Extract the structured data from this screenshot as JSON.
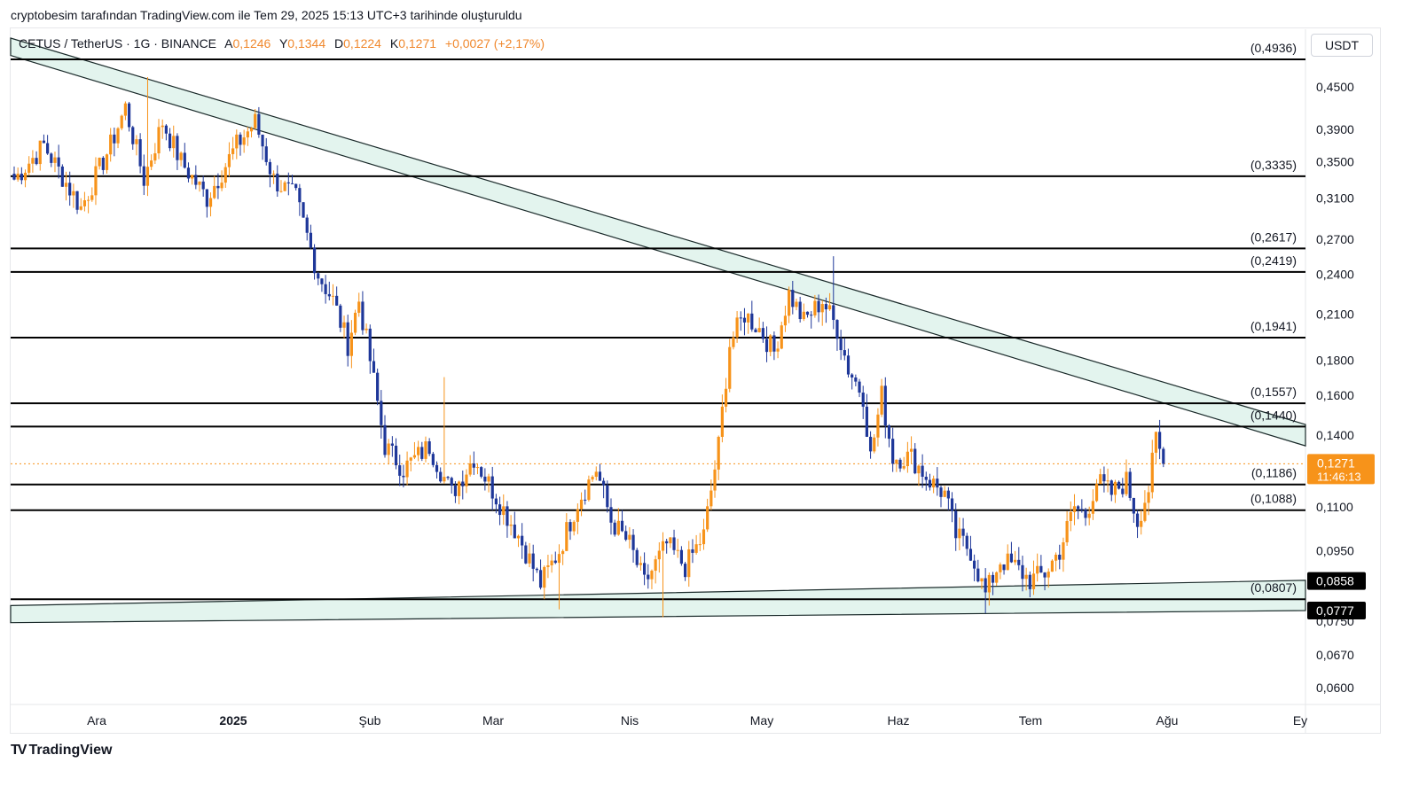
{
  "header": {
    "caption": "cryptobesim tarafından TradingView.com ile Tem 29, 2025 15:13 UTC+3 tarihinde oluşturuldu"
  },
  "symbol": {
    "name": "CETUS / TetherUS · 1G · BINANCE",
    "open_label": "A",
    "open": "0,1246",
    "high_label": "Y",
    "high": "0,1344",
    "low_label": "D",
    "low": "0,1224",
    "close_label": "K",
    "close": "0,1271",
    "change": "+0,0027 (+2,17%)"
  },
  "currency": "USDT",
  "footer": {
    "brand": "TradingView"
  },
  "colors": {
    "up": "#f7931a",
    "down": "#1e3799",
    "channel_fill": "#e3f4ee",
    "level_line": "#000000",
    "price_badge": "#f7931a"
  },
  "chart_data": {
    "type": "candlestick",
    "y_scale": "log",
    "ylim": [
      0.0567,
      0.546
    ],
    "y_ticks": [
      "0,4500",
      "0,3900",
      "0,3500",
      "0,3100",
      "0,2700",
      "0,2400",
      "0,2100",
      "0,1800",
      "0,1600",
      "0,1400",
      "0,1100",
      "0,0950",
      "0,0670",
      "0,0600",
      "0,0750"
    ],
    "x_ticks": [
      {
        "label": "Ara",
        "bold": false
      },
      {
        "label": "2025",
        "bold": true
      },
      {
        "label": "Şub",
        "bold": false
      },
      {
        "label": "Mar",
        "bold": false
      },
      {
        "label": "Nis",
        "bold": false
      },
      {
        "label": "May",
        "bold": false
      },
      {
        "label": "Haz",
        "bold": false
      },
      {
        "label": "Tem",
        "bold": false
      },
      {
        "label": "Ağu",
        "bold": false
      },
      {
        "label": "Ey",
        "bold": false
      }
    ],
    "levels": [
      "(0,4936)",
      "(0,3335)",
      "(0,2617)",
      "(0,2419)",
      "(0,1941)",
      "(0,1557)",
      "(0,1440)",
      "(0,1186)",
      "(0,1088)",
      "(0,0807)"
    ],
    "price_badges": [
      {
        "value": "0,1271",
        "timer": "11:46:13",
        "style": "current"
      },
      {
        "value": "0,0858",
        "style": "dark"
      },
      {
        "value": "0,0777",
        "style": "dark"
      }
    ],
    "channels": [
      {
        "name": "",
        "upper": [
          0.53,
          0.145
        ],
        "lower": [
          0.5,
          0.135
        ]
      },
      {
        "name": "",
        "upper": [
          0.079,
          0.086
        ],
        "lower": [
          0.0746,
          0.0777
        ]
      }
    ],
    "anchors": [
      {
        "day": 0,
        "close": 0.33
      },
      {
        "day": 8,
        "close": 0.37
      },
      {
        "day": 18,
        "close": 0.3
      },
      {
        "day": 26,
        "close": 0.37
      },
      {
        "day": 30,
        "close": 0.42
      },
      {
        "day": 35,
        "close": 0.33
      },
      {
        "day": 40,
        "close": 0.4
      },
      {
        "day": 45,
        "close": 0.35
      },
      {
        "day": 52,
        "close": 0.31
      },
      {
        "day": 60,
        "close": 0.37
      },
      {
        "day": 65,
        "close": 0.4
      },
      {
        "day": 70,
        "close": 0.33
      },
      {
        "day": 76,
        "close": 0.31
      },
      {
        "day": 82,
        "close": 0.24
      },
      {
        "day": 86,
        "close": 0.22
      },
      {
        "day": 90,
        "close": 0.19
      },
      {
        "day": 93,
        "close": 0.22
      },
      {
        "day": 96,
        "close": 0.18
      },
      {
        "day": 100,
        "close": 0.135
      },
      {
        "day": 105,
        "close": 0.125
      },
      {
        "day": 112,
        "close": 0.135
      },
      {
        "day": 118,
        "close": 0.115
      },
      {
        "day": 124,
        "close": 0.13
      },
      {
        "day": 130,
        "close": 0.114
      },
      {
        "day": 136,
        "close": 0.1
      },
      {
        "day": 142,
        "close": 0.085
      },
      {
        "day": 147,
        "close": 0.095
      },
      {
        "day": 152,
        "close": 0.112
      },
      {
        "day": 157,
        "close": 0.125
      },
      {
        "day": 161,
        "close": 0.105
      },
      {
        "day": 166,
        "close": 0.097
      },
      {
        "day": 170,
        "close": 0.085
      },
      {
        "day": 176,
        "close": 0.097
      },
      {
        "day": 181,
        "close": 0.09
      },
      {
        "day": 186,
        "close": 0.1
      },
      {
        "day": 190,
        "close": 0.135
      },
      {
        "day": 193,
        "close": 0.19
      },
      {
        "day": 197,
        "close": 0.21
      },
      {
        "day": 201,
        "close": 0.2
      },
      {
        "day": 205,
        "close": 0.185
      },
      {
        "day": 209,
        "close": 0.225
      },
      {
        "day": 213,
        "close": 0.205
      },
      {
        "day": 218,
        "close": 0.22
      },
      {
        "day": 222,
        "close": 0.2
      },
      {
        "day": 225,
        "close": 0.175
      },
      {
        "day": 229,
        "close": 0.16
      },
      {
        "day": 231,
        "close": 0.13
      },
      {
        "day": 234,
        "close": 0.16
      },
      {
        "day": 237,
        "close": 0.13
      },
      {
        "day": 242,
        "close": 0.13
      },
      {
        "day": 247,
        "close": 0.12
      },
      {
        "day": 251,
        "close": 0.115
      },
      {
        "day": 254,
        "close": 0.1
      },
      {
        "day": 258,
        "close": 0.095
      },
      {
        "day": 262,
        "close": 0.082
      },
      {
        "day": 266,
        "close": 0.092
      },
      {
        "day": 270,
        "close": 0.09
      },
      {
        "day": 274,
        "close": 0.086
      },
      {
        "day": 278,
        "close": 0.088
      },
      {
        "day": 282,
        "close": 0.095
      },
      {
        "day": 286,
        "close": 0.11
      },
      {
        "day": 289,
        "close": 0.107
      },
      {
        "day": 292,
        "close": 0.12
      },
      {
        "day": 296,
        "close": 0.115
      },
      {
        "day": 300,
        "close": 0.12
      },
      {
        "day": 303,
        "close": 0.105
      },
      {
        "day": 306,
        "close": 0.117
      },
      {
        "day": 308,
        "close": 0.138
      },
      {
        "day": 310,
        "close": 0.1271
      }
    ],
    "spikes": [
      {
        "day": 36,
        "high": 0.465
      },
      {
        "day": 116,
        "high": 0.17
      },
      {
        "day": 221,
        "high": 0.255
      },
      {
        "day": 147,
        "low": 0.078
      },
      {
        "day": 175,
        "low": 0.076
      },
      {
        "day": 262,
        "low": 0.077
      }
    ],
    "total_days": 311
  }
}
